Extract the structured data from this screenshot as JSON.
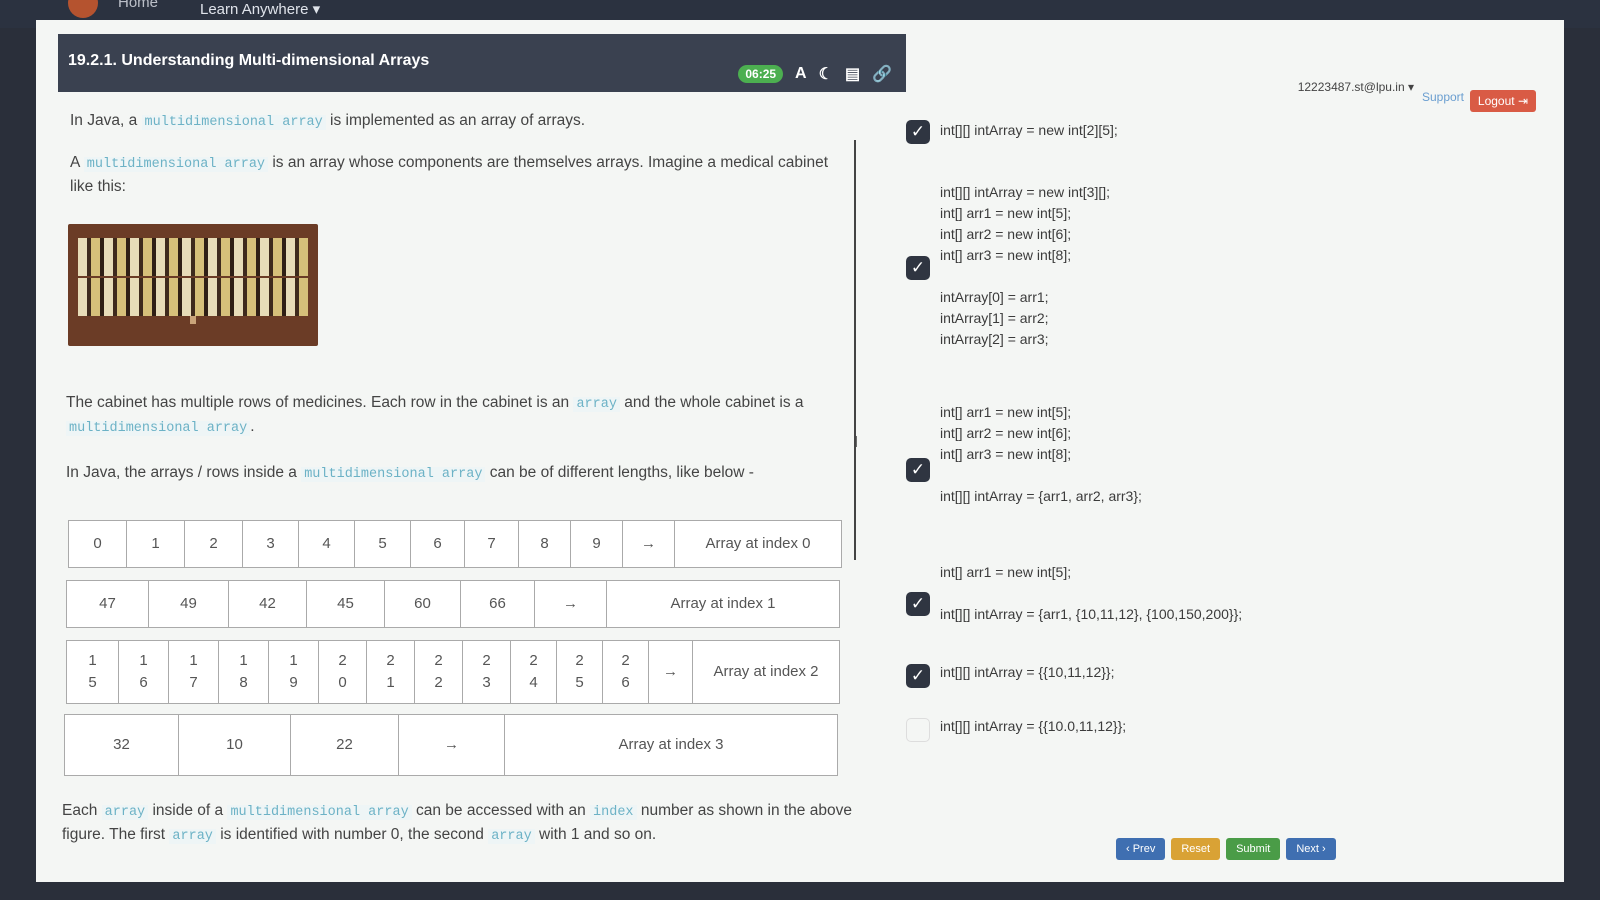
{
  "topbar": {
    "home": "Home",
    "learn": "Learn Anywhere ▾"
  },
  "header": {
    "title": "19.2.1. Understanding Multi-dimensional Arrays",
    "timer": "06:25"
  },
  "account": {
    "user": "12223487.st@lpu.in ▾",
    "support": "Support",
    "logout": "Logout ⇥"
  },
  "content": {
    "p1_a": "In Java, a ",
    "p1_code": "multidimensional array",
    "p1_b": " is implemented as an array of arrays.",
    "p2_a": "A ",
    "p2_code": "multidimensional array",
    "p2_b": " is an array whose components are themselves arrays. Imagine a medical cabinet like this:",
    "p3_a": "The cabinet has multiple rows of medicines. Each row in the cabinet is an ",
    "p3_code1": "array",
    "p3_b": " and the whole cabinet is a ",
    "p3_code2": "multidimensional array",
    "p3_c": ".",
    "p4_a": "In Java, the arrays / rows inside a ",
    "p4_code": "multidimensional array",
    "p4_b": " can be of different lengths, like below -",
    "p5_a": "Each ",
    "p5_code1": "array",
    "p5_b": " inside of a ",
    "p5_code2": "multidimensional array",
    "p5_c": " can be accessed with an ",
    "p5_code3": "index",
    "p5_d": " number as shown in the above figure. The first ",
    "p5_code4": "array",
    "p5_e": " is identified with number 0, the second ",
    "p5_code5": "array",
    "p5_f": " with 1 and so on."
  },
  "arrays": [
    {
      "cells": [
        "0",
        "1",
        "2",
        "3",
        "4",
        "5",
        "6",
        "7",
        "8",
        "9",
        "→"
      ],
      "label": "Array at index 0"
    },
    {
      "cells": [
        "47",
        "49",
        "42",
        "45",
        "60",
        "66",
        "→"
      ],
      "label": "Array at index 1"
    },
    {
      "cells": [
        "1\n5",
        "1\n6",
        "1\n7",
        "1\n8",
        "1\n9",
        "2\n0",
        "2\n1",
        "2\n2",
        "2\n3",
        "2\n4",
        "2\n5",
        "2\n6",
        "→"
      ],
      "label": "Array at index 2"
    },
    {
      "cells": [
        "32",
        "10",
        "22",
        "→"
      ],
      "label": "Array at index 3"
    }
  ],
  "options": [
    {
      "checked": true,
      "code": "int[][] intArray = new int[2][5];"
    },
    {
      "checked": true,
      "code": "int[][] intArray = new int[3][];\nint[] arr1 = new int[5];\nint[] arr2 = new int[6];\nint[] arr3 = new int[8];\n\nintArray[0] = arr1;\nintArray[1] = arr2;\nintArray[2] = arr3;"
    },
    {
      "checked": true,
      "code": "int[] arr1 = new int[5];\nint[] arr2 = new int[6];\nint[] arr3 = new int[8];\n\nint[][] intArray = {arr1, arr2, arr3};"
    },
    {
      "checked": true,
      "code": "int[] arr1 = new int[5];\n\nint[][] intArray = {arr1, {10,11,12}, {100,150,200}};"
    },
    {
      "checked": true,
      "code": "int[][] intArray = {{10,11,12}};"
    },
    {
      "checked": false,
      "code": "int[][] intArray = {{10.0,11,12}};"
    }
  ],
  "nav": {
    "prev": "‹ Prev",
    "reset": "Reset",
    "submit": "Submit",
    "next": "Next ›"
  }
}
